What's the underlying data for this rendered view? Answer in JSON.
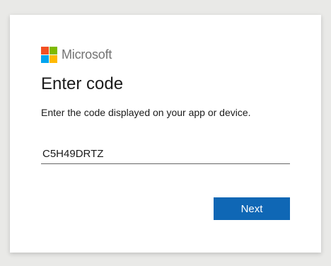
{
  "brand": {
    "name": "Microsoft",
    "logo_colors": [
      "#f25022",
      "#7fba00",
      "#00a4ef",
      "#ffb900"
    ]
  },
  "page": {
    "title": "Enter code",
    "subtitle": "Enter the code displayed on your app or device."
  },
  "code_field": {
    "value": "C5H49DRTZ"
  },
  "actions": {
    "next_label": "Next"
  },
  "colors": {
    "accent": "#0f67b5",
    "background": "#e9e9e7",
    "card": "#ffffff"
  }
}
